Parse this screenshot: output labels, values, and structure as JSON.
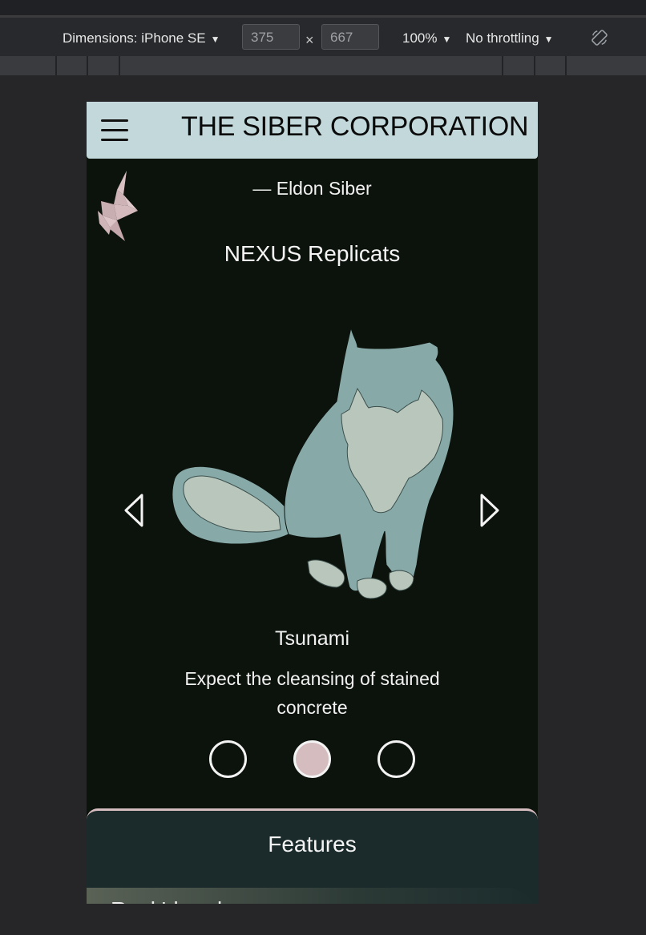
{
  "devtools": {
    "dimensions_label": "Dimensions: iPhone SE",
    "width_value": "375",
    "height_value": "667",
    "times": "×",
    "zoom": "100%",
    "throttling": "No throttling"
  },
  "header": {
    "brand": "THE SIBER CORPORATION"
  },
  "quote": {
    "attribution": "— Eldon Siber"
  },
  "carousel": {
    "title": "NEXUS Replicats",
    "item_name": "Tsunami",
    "item_description": "Expect the cleansing of stained concrete",
    "active_index": 1
  },
  "features": {
    "title": "Features",
    "first_card": "Rock'd and..."
  },
  "colors": {
    "header_bg": "#c2d8da",
    "page_bg": "#0c120c",
    "accent_pink": "#d4bcbf",
    "cat_body": "#87aaa9",
    "cat_light": "#b8c6bb",
    "features_bg": "#1b2b2c"
  }
}
